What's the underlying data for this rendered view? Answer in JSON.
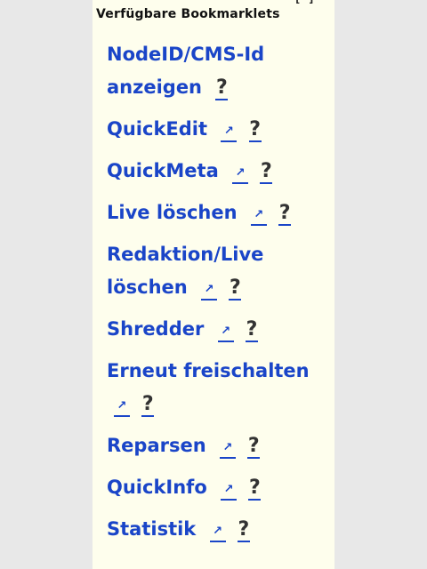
{
  "panel": {
    "corner_label": "[*]",
    "heading": "Verfügbare Bookmarklets",
    "ext_icon_glyph": "↗",
    "help_label": "?"
  },
  "bookmarklets": [
    {
      "label": "NodeID/CMS-Id anzeigen",
      "has_external": false
    },
    {
      "label": "QuickEdit",
      "has_external": true
    },
    {
      "label": "QuickMeta",
      "has_external": true
    },
    {
      "label": "Live löschen",
      "has_external": true
    },
    {
      "label": "Redaktion/Live löschen",
      "has_external": true
    },
    {
      "label": "Shredder",
      "has_external": true
    },
    {
      "label": "Erneut freischalten",
      "has_external": true
    },
    {
      "label": "Reparsen",
      "has_external": true
    },
    {
      "label": "QuickInfo",
      "has_external": true
    },
    {
      "label": "Statistik",
      "has_external": true
    }
  ],
  "colors": {
    "link": "#1a45c8",
    "panel_bg": "#fefeed",
    "page_bg": "#e8e8e8"
  }
}
